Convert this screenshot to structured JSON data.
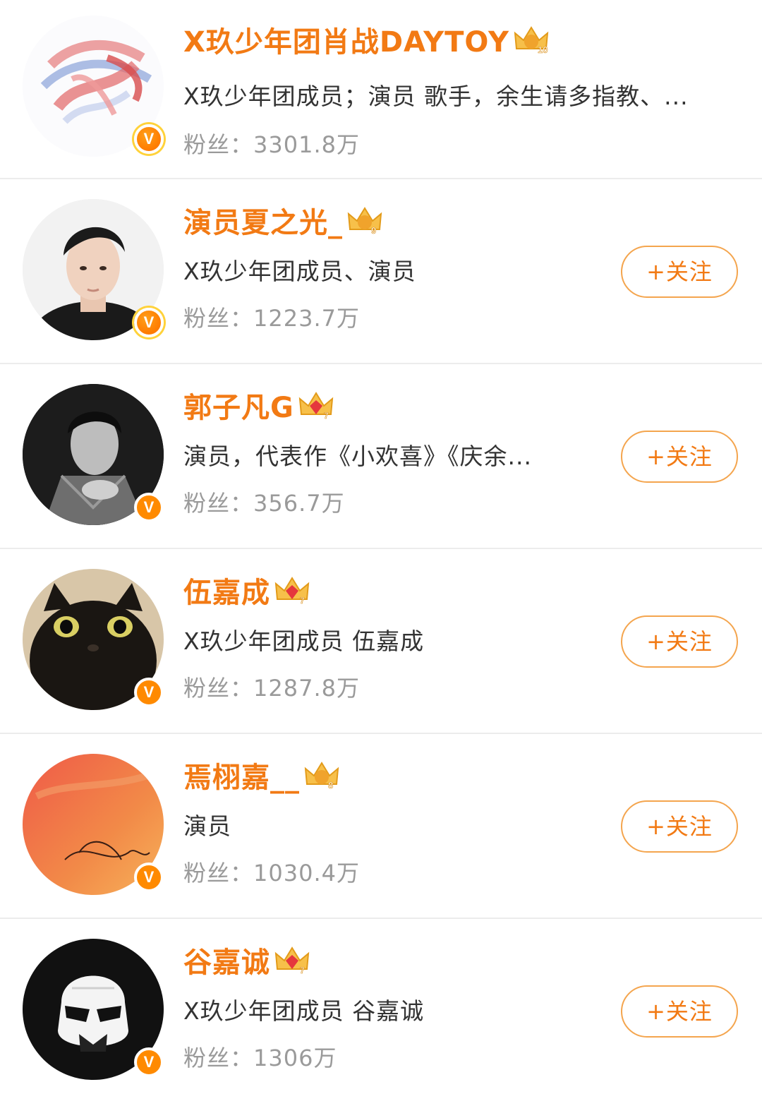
{
  "users": [
    {
      "name": "X玖少年团肖战DAYTOY",
      "crown_level": "10",
      "description": "X玖少年团成员；演员 歌手，余生请多指教、...",
      "fans": "粉丝：3301.8万",
      "follow_label": "",
      "verified": true
    },
    {
      "name": "演员夏之光_",
      "crown_level": "9",
      "description": "X玖少年团成员、演员",
      "fans": "粉丝：1223.7万",
      "follow_label": "+关注",
      "verified": true
    },
    {
      "name": "郭子凡G",
      "crown_level": "7",
      "description": "演员，代表作《小欢喜》《庆余...",
      "fans": "粉丝：356.7万",
      "follow_label": "+关注",
      "verified": true
    },
    {
      "name": "伍嘉成",
      "crown_level": "7",
      "description": "X玖少年团成员 伍嘉成",
      "fans": "粉丝：1287.8万",
      "follow_label": "+关注",
      "verified": true
    },
    {
      "name": "焉栩嘉__",
      "crown_level": "8",
      "description": "演员",
      "fans": "粉丝：1030.4万",
      "follow_label": "+关注",
      "verified": true
    },
    {
      "name": "谷嘉诚",
      "crown_level": "7",
      "description": "X玖少年团成员 谷嘉诚",
      "fans": "粉丝：1306万",
      "follow_label": "+关注",
      "verified": true
    }
  ],
  "badge_letter": "V",
  "colors": {
    "name": "#f27a14",
    "fans": "#9a9a9a",
    "button_border": "#f4a54e",
    "badge": "#ff8a00",
    "divider": "#ececec"
  }
}
